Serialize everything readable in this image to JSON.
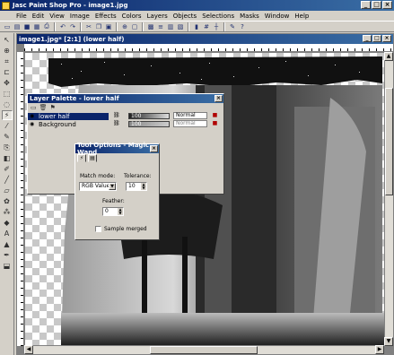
{
  "app": {
    "title": "Jasc Paint Shop Pro - image1.jpg"
  },
  "window_buttons": [
    "_",
    "□",
    "×"
  ],
  "menu": [
    "File",
    "Edit",
    "View",
    "Image",
    "Effects",
    "Colors",
    "Layers",
    "Objects",
    "Selections",
    "Masks",
    "Window",
    "Help"
  ],
  "toolbar": [
    "new-icon",
    "open-icon",
    "save-icon",
    "scan-icon",
    "print-icon",
    "sep",
    "undo-icon",
    "redo-icon",
    "sep",
    "cut-icon",
    "copy-icon",
    "paste-icon",
    "sep",
    "zoom-icon",
    "fullscreen-icon",
    "sep",
    "palette-icon",
    "layers-icon",
    "overview-icon",
    "tooloptions-icon",
    "sep",
    "histogram-icon",
    "grid-icon",
    "guides-icon",
    "sep",
    "brush-icon",
    "help-icon"
  ],
  "document": {
    "title": "image1.jpg* [2:1] (lower half)"
  },
  "layer_palette": {
    "title": "Layer Palette - lower half",
    "layers": [
      {
        "name": "lower half",
        "opacity": "100",
        "blend": "Normal",
        "selected": true
      },
      {
        "name": "Background",
        "opacity": "100",
        "blend": "Normal",
        "selected": false
      }
    ]
  },
  "tool_options": {
    "title": "Tool Options - Magic Wand",
    "match_mode_label": "Match mode:",
    "match_mode_value": "RGB Value",
    "tolerance_label": "Tolerance:",
    "tolerance_value": "10",
    "feather_label": "Feather:",
    "feather_value": "0",
    "sample_merged_label": "Sample merged"
  },
  "colors": {
    "title_active": "#0a246a",
    "title_gradient_end": "#3a6ea5",
    "chrome": "#d4d0c8",
    "selection": "#0a246a"
  }
}
